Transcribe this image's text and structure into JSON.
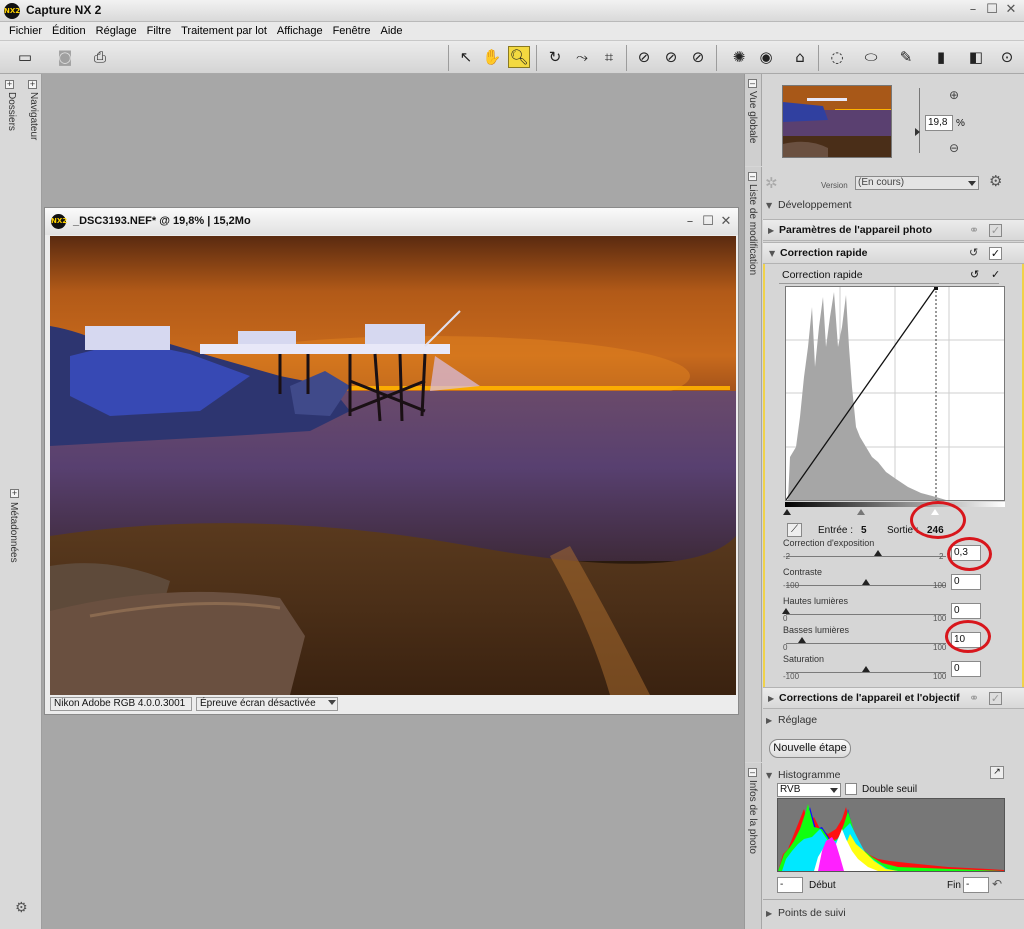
{
  "app": {
    "title": "Capture NX 2",
    "logo_text": "NX2"
  },
  "menu": [
    "Fichier",
    "Édition",
    "Réglage",
    "Filtre",
    "Traitement par lot",
    "Affichage",
    "Fenêtre",
    "Aide"
  ],
  "left_panel": {
    "tabs": [
      "Dossiers",
      "Navigateur",
      "Métadonnées"
    ]
  },
  "document": {
    "title": "_DSC3193.NEF* @ 19,8% | 15,2Mo",
    "status": [
      "Nikon Adobe RGB 4.0.0.3001",
      "Épreuve écran désactivée"
    ]
  },
  "overview": {
    "tab": "Vue globale",
    "zoom_value": "19,8",
    "zoom_unit": "%"
  },
  "edit_list": {
    "tab": "Liste de modification",
    "version_label": "Version",
    "version_value": "(En cours)",
    "developpement": "Développement",
    "params_appareil": "Paramètres de l'appareil photo",
    "correction_rapide": "Correction rapide",
    "correction_rapide_sub": "Correction rapide",
    "entree_label": "Entrée :",
    "entree_value": "5",
    "sortie_label": "Sortie :",
    "sortie_value": "246",
    "sliders": [
      {
        "label": "Correction d'exposition",
        "min": "-2",
        "max": "2",
        "value": "0,3",
        "level": 0.575
      },
      {
        "label": "Contraste",
        "min": "-100",
        "max": "100",
        "value": "0",
        "level": 0.5
      },
      {
        "label": "Hautes lumières",
        "min": "0",
        "max": "100",
        "value": "0",
        "level": 0.0
      },
      {
        "label": "Basses lumières",
        "min": "0",
        "max": "100",
        "value": "10",
        "level": 0.1
      },
      {
        "label": "Saturation",
        "min": "-100",
        "max": "100",
        "value": "0",
        "level": 0.5
      }
    ],
    "corrections_objectif": "Corrections de l'appareil et l'objectif",
    "reglage": "Réglage",
    "nouvelle_etape": "Nouvelle étape"
  },
  "photo_info": {
    "tab": "Infos de la photo",
    "histogramme": "Histogramme",
    "channel": "RVB",
    "double_seuil": "Double seuil",
    "debut_label": "Début",
    "debut_value": "-",
    "fin_label": "Fin",
    "fin_value": "-",
    "points_suivi": "Points de suivi"
  },
  "colors": {
    "accent_yellow": "#f3d940",
    "annotation_red": "#d8161c"
  }
}
